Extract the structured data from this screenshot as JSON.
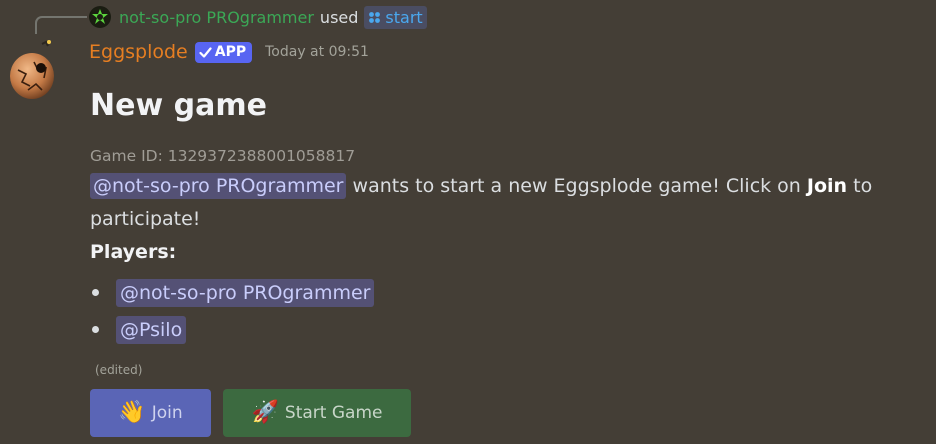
{
  "interaction": {
    "user": "not-so-pro PROgrammer",
    "used_label": "used",
    "command": "start"
  },
  "message": {
    "author": "Eggsplode",
    "badge": "APP",
    "timestamp": "Today at 09:51",
    "title": "New game",
    "game_id": "Game ID: 1329372388001058817",
    "description": {
      "mention": "@not-so-pro PROgrammer",
      "text_before_join": " wants to start a new Eggsplode game! Click on ",
      "join_word": "Join",
      "text_after_join": " to participate!"
    },
    "players_heading": "Players:",
    "players": [
      "@not-so-pro PROgrammer",
      "@Psilo"
    ],
    "edited_label": "(edited)"
  },
  "buttons": {
    "join": {
      "label": "Join",
      "icon": "waving-hand-icon",
      "color": "#5a65b6"
    },
    "start": {
      "label": "Start Game",
      "icon": "rocket-icon",
      "color": "#3c6a40"
    }
  },
  "colors": {
    "background": "#443e36",
    "author": "#e67e22",
    "app_badge": "#5865f2",
    "mention_bg": "#545175",
    "command_user": "#3ba856",
    "command": "#4aa8ef"
  }
}
